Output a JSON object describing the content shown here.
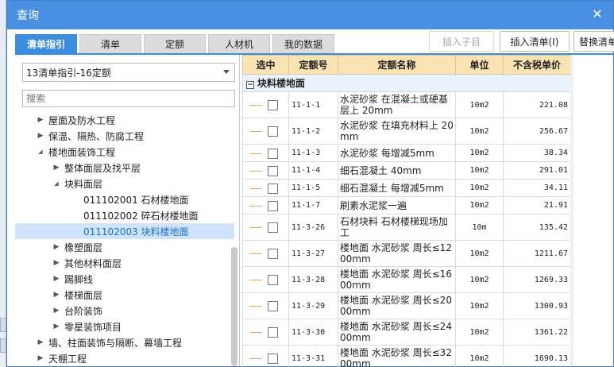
{
  "dialog": {
    "title": "查询"
  },
  "tabs": [
    {
      "label": "清单指引",
      "active": true
    },
    {
      "label": "清单",
      "active": false
    },
    {
      "label": "定额",
      "active": false
    },
    {
      "label": "人材机",
      "active": false
    },
    {
      "label": "我的数据",
      "active": false
    }
  ],
  "actions": {
    "insert_child": "插入子目",
    "insert_list": "插入清单(I)",
    "replace_list": "替换清单"
  },
  "left": {
    "select_value": "13清单指引-16定额",
    "search_placeholder": "搜索",
    "tree": [
      {
        "label": "屋面及防水工程",
        "level": 1,
        "arrow": "right"
      },
      {
        "label": "保温、隔热、防腐工程",
        "level": 1,
        "arrow": "right"
      },
      {
        "label": "楼地面装饰工程",
        "level": 1,
        "arrow": "down"
      },
      {
        "label": "整体面层及找平层",
        "level": 2,
        "arrow": "right"
      },
      {
        "label": "块料面层",
        "level": 2,
        "arrow": "down"
      },
      {
        "label": "011102001  石材楼地面",
        "level": 3,
        "arrow": ""
      },
      {
        "label": "011102002  碎石材楼地面",
        "level": 3,
        "arrow": ""
      },
      {
        "label": "011102003  块料楼地面",
        "level": 3,
        "arrow": "",
        "selected": true
      },
      {
        "label": "橡塑面层",
        "level": 2,
        "arrow": "right"
      },
      {
        "label": "其他材料面层",
        "level": 2,
        "arrow": "right"
      },
      {
        "label": "踢脚线",
        "level": 2,
        "arrow": "right"
      },
      {
        "label": "楼梯面层",
        "level": 2,
        "arrow": "right"
      },
      {
        "label": "台阶装饰",
        "level": 2,
        "arrow": "right"
      },
      {
        "label": "零星装饰项目",
        "level": 2,
        "arrow": "right"
      },
      {
        "label": "墙、柱面装饰与隔断、幕墙工程",
        "level": 1,
        "arrow": "right"
      },
      {
        "label": "天棚工程",
        "level": 1,
        "arrow": "right"
      }
    ]
  },
  "table": {
    "headers": [
      "选中",
      "定额号",
      "定额名称",
      "单位",
      "不含税单价"
    ],
    "group": "块料楼地面",
    "rows": [
      {
        "code": "11-1-1",
        "name": "水泥砂浆 在混凝土或硬基层上 20mm",
        "unit": "10m2",
        "price": "221.08"
      },
      {
        "code": "11-1-2",
        "name": "水泥砂浆 在填充材料上 20mm",
        "unit": "10m2",
        "price": "256.67"
      },
      {
        "code": "11-1-3",
        "name": "水泥砂浆 每增减5mm",
        "unit": "10m2",
        "price": "38.34"
      },
      {
        "code": "11-1-4",
        "name": "细石混凝土 40mm",
        "unit": "10m2",
        "price": "291.01"
      },
      {
        "code": "11-1-5",
        "name": "细石混凝土 每增减5mm",
        "unit": "10m2",
        "price": "34.11"
      },
      {
        "code": "11-1-7",
        "name": "刷素水泥浆一遍",
        "unit": "10m2",
        "price": "21.91"
      },
      {
        "code": "11-3-26",
        "name": "石材块料 石材楼梯现场加工",
        "unit": "10m",
        "price": "135.42"
      },
      {
        "code": "11-3-27",
        "name": "楼地面 水泥砂浆 周长≤1200mm",
        "unit": "10m2",
        "price": "1211.67"
      },
      {
        "code": "11-3-28",
        "name": "楼地面 水泥砂浆 周长≤1600mm",
        "unit": "10m2",
        "price": "1269.33"
      },
      {
        "code": "11-3-29",
        "name": "楼地面 水泥砂浆 周长≤2000mm",
        "unit": "10m2",
        "price": "1300.93"
      },
      {
        "code": "11-3-30",
        "name": "楼地面 水泥砂浆 周长≤2400mm",
        "unit": "10m2",
        "price": "1361.22"
      },
      {
        "code": "11-3-31",
        "name": "楼地面 水泥砂浆 周长≤3200mm",
        "unit": "10m2",
        "price": "1690.13"
      }
    ]
  }
}
